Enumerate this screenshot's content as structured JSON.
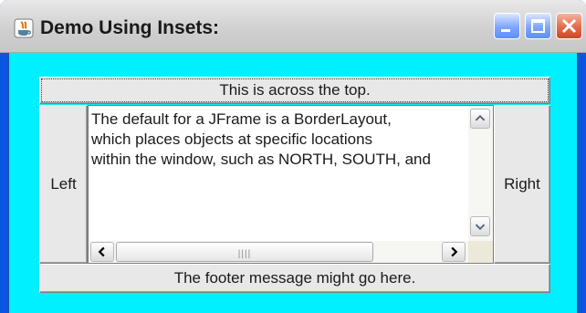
{
  "window": {
    "title": "Demo Using Insets:",
    "icons": {
      "app": "java-icon",
      "minimize": "minimize-icon",
      "maximize": "maximize-icon",
      "close": "close-icon"
    }
  },
  "layout_regions": {
    "north_button": "This is across the top.",
    "west_button": "Left",
    "east_button": "Right",
    "south_button": "The footer message might go here."
  },
  "text_area": {
    "lines": [
      "The default for a JFrame is a BorderLayout,",
      "which places objects at specific locations",
      "within the window, such as NORTH, SOUTH, and"
    ]
  },
  "colors": {
    "content_background": "#00f0ff",
    "titlebar": "#d7d7d7"
  }
}
